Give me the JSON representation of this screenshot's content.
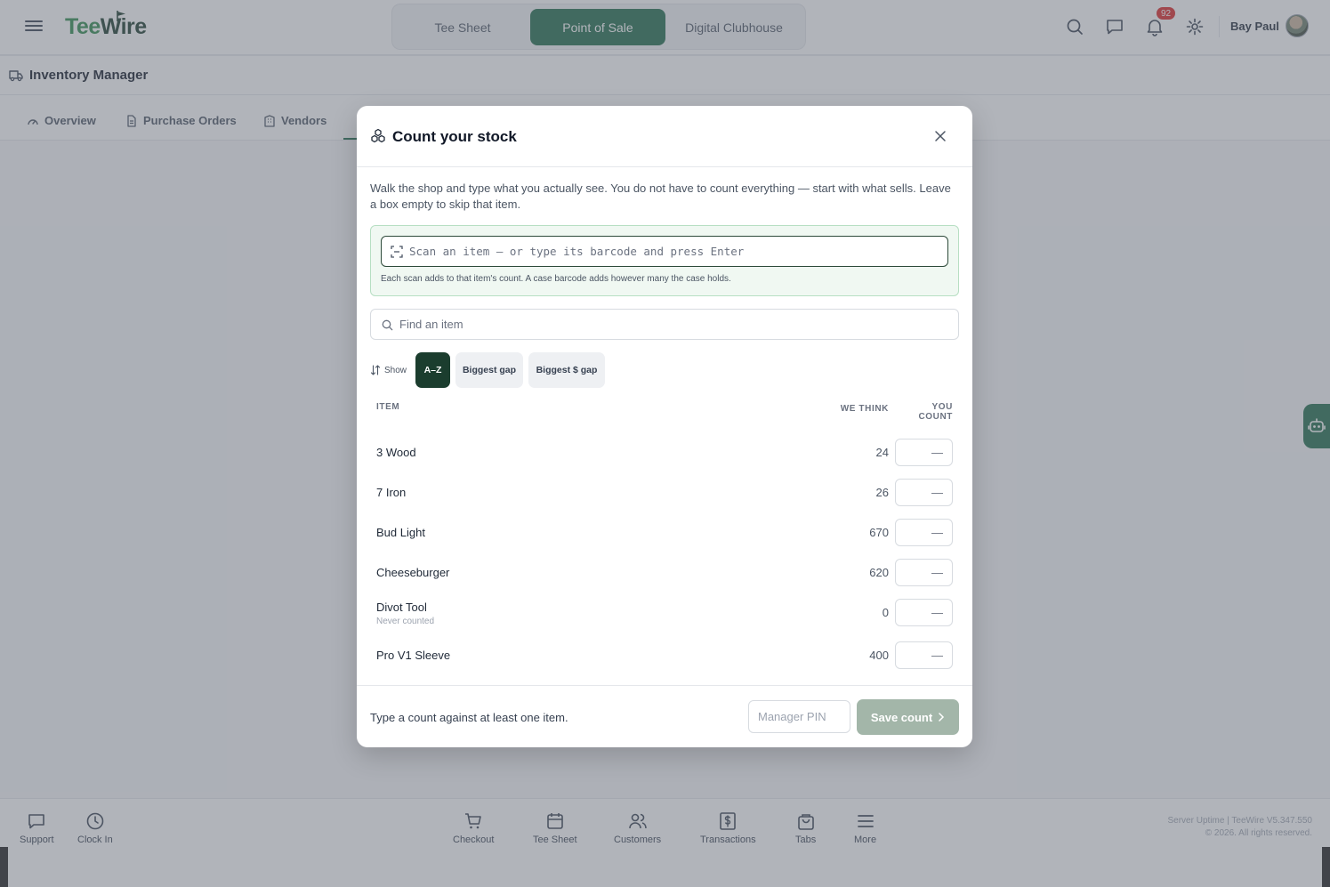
{
  "app": {
    "logo_tee": "Tee",
    "logo_wire": "Wire",
    "nav": [
      "Tee Sheet",
      "Point of Sale",
      "Digital Clubhouse"
    ],
    "active_nav": "Point of Sale",
    "notification_count": "92",
    "user_name": "Bay Paul"
  },
  "page": {
    "title": "Inventory Manager",
    "tabs": [
      "Overview",
      "Purchase Orders",
      "Vendors"
    ]
  },
  "modal": {
    "title": "Count your stock",
    "intro": "Walk the shop and type what you actually see. You do not have to count everything — start with what sells. Leave a box empty to skip that item.",
    "scan_placeholder": "Scan an item — or type its barcode and press Enter",
    "scan_note": "Each scan adds to that item's count. A case barcode adds however many the case holds.",
    "find_placeholder": "Find an item",
    "sort_label": "Show",
    "sort_options": [
      "A–Z",
      "Biggest gap",
      "Biggest $ gap"
    ],
    "active_sort": "A–Z",
    "col_item": "ITEM",
    "col_we_think": "WE THINK",
    "col_you_count": "YOU COUNT",
    "count_placeholder": "—",
    "items": [
      {
        "name": "3 Wood",
        "we_think": "24",
        "sub": ""
      },
      {
        "name": "7 Iron",
        "we_think": "26",
        "sub": ""
      },
      {
        "name": "Bud Light",
        "we_think": "670",
        "sub": ""
      },
      {
        "name": "Cheeseburger",
        "we_think": "620",
        "sub": ""
      },
      {
        "name": "Divot Tool",
        "we_think": "0",
        "sub": "Never counted"
      },
      {
        "name": "Pro V1 Sleeve",
        "we_think": "400",
        "sub": ""
      }
    ],
    "footer_hint": "Type a count against at least one item.",
    "pin_placeholder": "Manager PIN",
    "save_label": "Save count"
  },
  "bottom": {
    "left_items": [
      "Support",
      "Clock In"
    ],
    "center_items": [
      "Checkout",
      "Tee Sheet",
      "Customers",
      "Transactions",
      "Tabs",
      "More"
    ],
    "meta_line1": "Server Uptime  |  TeeWire V5.347.550",
    "meta_line2": "© 2026. All rights reserved."
  }
}
